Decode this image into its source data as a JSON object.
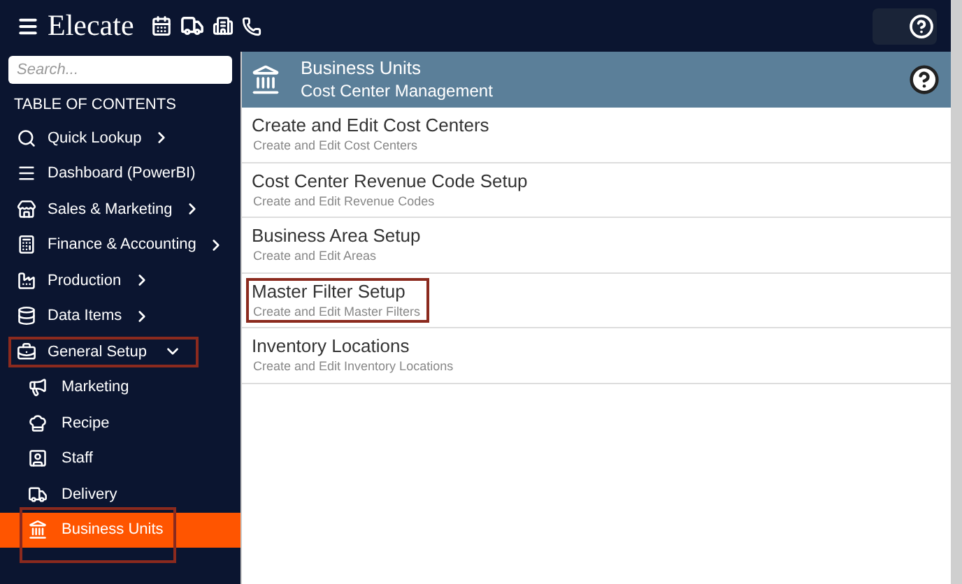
{
  "header": {
    "brand": "Elecate"
  },
  "sidebar": {
    "search": {
      "placeholder": "Search..."
    },
    "heading": "TABLE OF CONTENTS",
    "items": [
      {
        "label": "Quick Lookup",
        "expanded": false,
        "highlighted": false,
        "has_children": true
      },
      {
        "label": "Dashboard (PowerBI)",
        "expanded": false,
        "highlighted": false,
        "has_children": false
      },
      {
        "label": "Sales & Marketing",
        "expanded": false,
        "highlighted": false,
        "has_children": true
      },
      {
        "label": "Finance & Accounting",
        "expanded": false,
        "highlighted": false,
        "has_children": true
      },
      {
        "label": "Production",
        "expanded": false,
        "highlighted": false,
        "has_children": true
      },
      {
        "label": "Data Items",
        "expanded": false,
        "highlighted": false,
        "has_children": true
      },
      {
        "label": "General Setup",
        "expanded": true,
        "highlighted": true,
        "has_children": true,
        "children": [
          {
            "label": "Marketing",
            "selected": false,
            "highlighted": false
          },
          {
            "label": "Recipe",
            "selected": false,
            "highlighted": false
          },
          {
            "label": "Staff",
            "selected": false,
            "highlighted": false
          },
          {
            "label": "Delivery",
            "selected": false,
            "highlighted": false
          },
          {
            "label": "Business Units",
            "selected": true,
            "highlighted": true
          }
        ]
      }
    ]
  },
  "panel": {
    "title": "Business Units",
    "subtitle": "Cost Center Management",
    "items": [
      {
        "title": "Create and Edit Cost Centers",
        "description": "Create and Edit Cost Centers",
        "highlighted": false
      },
      {
        "title": "Cost Center Revenue Code Setup",
        "description": "Create and Edit Revenue Codes",
        "highlighted": false
      },
      {
        "title": "Business Area Setup",
        "description": "Create and Edit Areas",
        "highlighted": false
      },
      {
        "title": "Master Filter Setup",
        "description": "Create and Edit Master Filters",
        "highlighted": true
      },
      {
        "title": "Inventory Locations",
        "description": "Create and Edit Inventory Locations",
        "highlighted": false
      }
    ]
  }
}
